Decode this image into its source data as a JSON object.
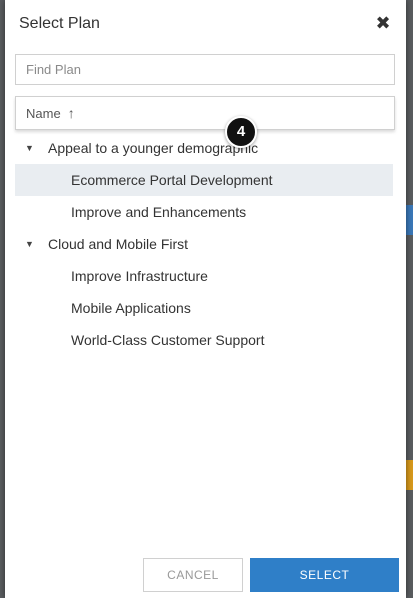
{
  "dialog": {
    "title": "Select Plan",
    "close_icon": "close-icon"
  },
  "search": {
    "placeholder": "Find Plan",
    "value": ""
  },
  "column": {
    "label": "Name",
    "sort_icon": "arrow-up-icon",
    "sort": "ascending"
  },
  "badge": "4",
  "tree": {
    "groups": [
      {
        "label": "Appeal to a younger demographic",
        "expanded": true,
        "children": [
          {
            "label": "Ecommerce Portal Development",
            "selected": true
          },
          {
            "label": "Improve and Enhancements",
            "selected": false
          }
        ]
      },
      {
        "label": "Cloud and Mobile First",
        "expanded": true,
        "children": [
          {
            "label": "Improve Infrastructure",
            "selected": false
          },
          {
            "label": "Mobile Applications",
            "selected": false
          },
          {
            "label": "World-Class Customer Support",
            "selected": false
          }
        ]
      }
    ]
  },
  "footer": {
    "cancel_label": "CANCEL",
    "select_label": "SELECT"
  },
  "colors": {
    "primary": "#2f7fc8",
    "selected_row": "#e9edf1"
  }
}
